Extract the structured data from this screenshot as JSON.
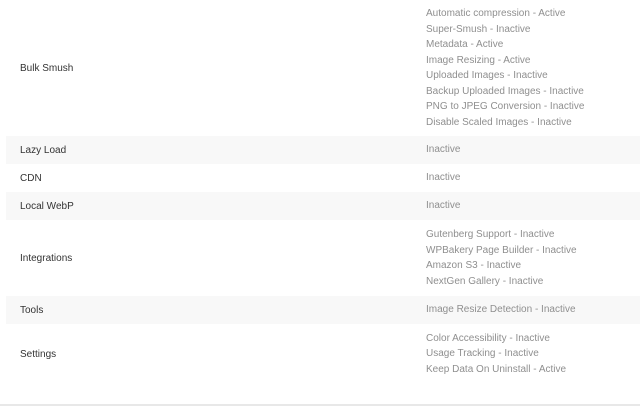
{
  "rows": [
    {
      "label": "Bulk Smush",
      "values": [
        "Automatic compression - Active",
        "Super-Smush - Inactive",
        "Metadata - Active",
        "Image Resizing - Active",
        "Uploaded Images - Inactive",
        "Backup Uploaded Images - Inactive",
        "PNG to JPEG Conversion - Inactive",
        "Disable Scaled Images - Inactive"
      ]
    },
    {
      "label": "Lazy Load",
      "values": [
        "Inactive"
      ]
    },
    {
      "label": "CDN",
      "values": [
        "Inactive"
      ]
    },
    {
      "label": "Local WebP",
      "values": [
        "Inactive"
      ]
    },
    {
      "label": "Integrations",
      "values": [
        "Gutenberg Support - Inactive",
        "WPBakery Page Builder - Inactive",
        "Amazon S3 - Inactive",
        "NextGen Gallery - Inactive"
      ]
    },
    {
      "label": "Tools",
      "values": [
        "Image Resize Detection - Inactive"
      ]
    },
    {
      "label": "Settings",
      "values": [
        "Color Accessibility - Inactive",
        "Usage Tracking - Inactive",
        "Keep Data On Uninstall - Active"
      ]
    }
  ]
}
